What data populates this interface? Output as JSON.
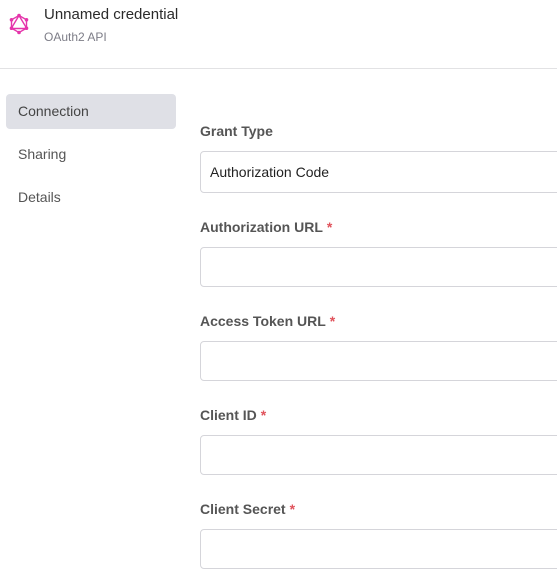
{
  "header": {
    "title": "Unnamed credential",
    "subtitle": "OAuth2 API",
    "logo_icon": "graphql-icon",
    "logo_color": "#e535ab"
  },
  "sidebar": {
    "items": [
      {
        "label": "Connection",
        "active": true
      },
      {
        "label": "Sharing",
        "active": false
      },
      {
        "label": "Details",
        "active": false
      }
    ]
  },
  "form": {
    "required_marker": "*",
    "grant_type": {
      "label": "Grant Type",
      "value": "Authorization Code"
    },
    "authorization_url": {
      "label": "Authorization URL",
      "value": "",
      "required": true
    },
    "access_token_url": {
      "label": "Access Token URL",
      "value": "",
      "required": true
    },
    "client_id": {
      "label": "Client ID",
      "value": "",
      "required": true
    },
    "client_secret": {
      "label": "Client Secret",
      "value": "",
      "required": true
    }
  },
  "colors": {
    "accent_required": "#e0525b",
    "nav_active_bg": "#dfe0e6",
    "border": "#d5d5da"
  }
}
